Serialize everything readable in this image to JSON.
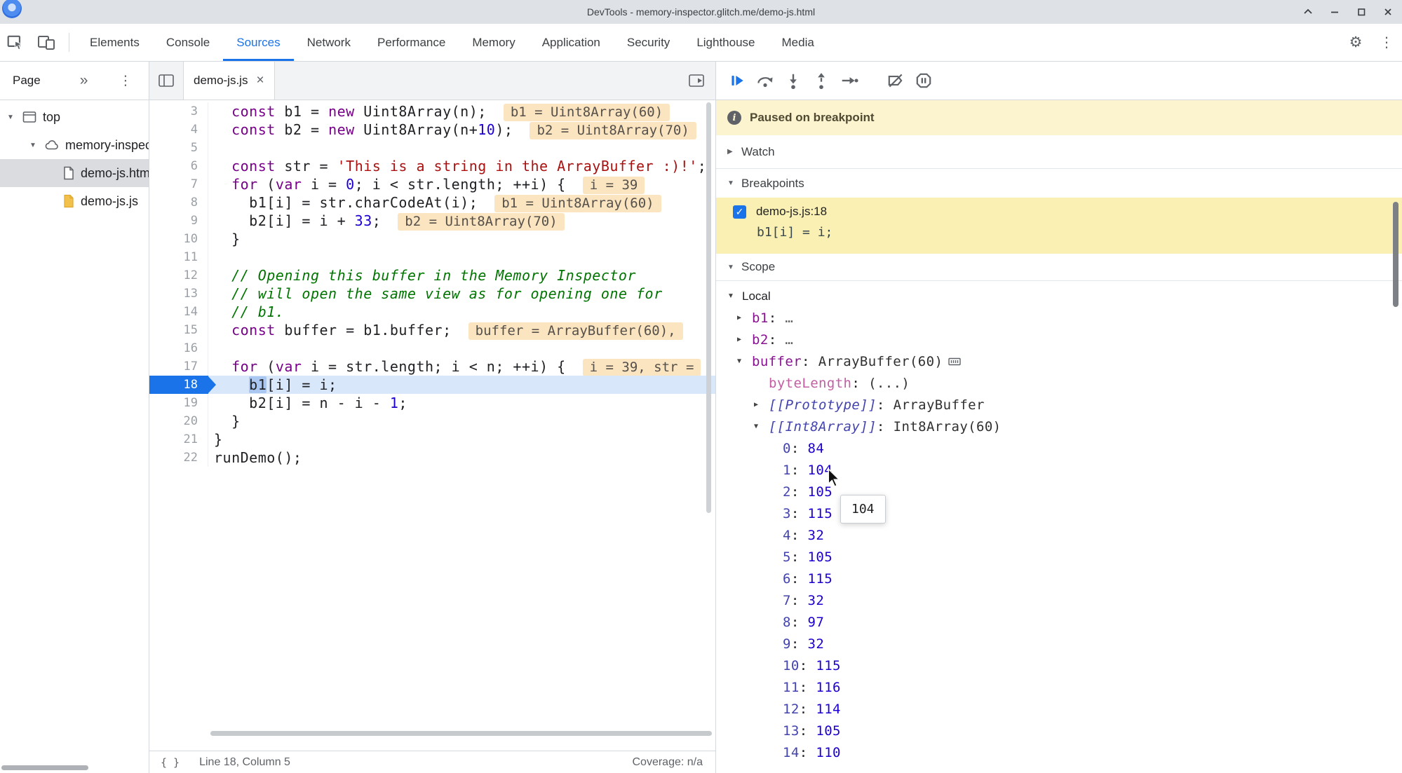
{
  "window": {
    "title": "DevTools - memory-inspector.glitch.me/demo-js.html"
  },
  "icons": {
    "close_tab": "×",
    "kebab": "⋮",
    "chevrons": "»",
    "braces": "{ }",
    "gear": "⚙",
    "tri_r": "▶",
    "tri_d": "▼",
    "info": "i",
    "check": "✓"
  },
  "main_tabs": {
    "items": [
      "Elements",
      "Console",
      "Sources",
      "Network",
      "Performance",
      "Memory",
      "Application",
      "Security",
      "Lighthouse",
      "Media"
    ],
    "active": "Sources"
  },
  "sidebar": {
    "tab_label": "Page",
    "tree": [
      {
        "label": "top",
        "icon": "frame",
        "indent": 0,
        "expander": true,
        "selected": false
      },
      {
        "label": "memory-inspector.glitch.me",
        "icon": "cloud",
        "indent": 1,
        "expander": true,
        "selected": false
      },
      {
        "label": "demo-js.html",
        "icon": "doc-html",
        "indent": 2,
        "expander": false,
        "selected": true
      },
      {
        "label": "demo-js.js",
        "icon": "doc-js",
        "indent": 2,
        "expander": false,
        "selected": false
      }
    ]
  },
  "editor": {
    "tab_label": "demo-js.js",
    "status_line": "Line 18, Column 5",
    "coverage": "Coverage: n/a",
    "current_line": 18,
    "lines": [
      {
        "n": 3,
        "tk": [
          [
            "t",
            "  "
          ],
          [
            "k",
            "const"
          ],
          [
            "t",
            " b1 = "
          ],
          [
            "k",
            "new"
          ],
          [
            "t",
            " Uint8Array(n);"
          ]
        ],
        "hint": "b1 = Uint8Array(60)"
      },
      {
        "n": 4,
        "tk": [
          [
            "t",
            "  "
          ],
          [
            "k",
            "const"
          ],
          [
            "t",
            " b2 = "
          ],
          [
            "k",
            "new"
          ],
          [
            "t",
            " Uint8Array(n+"
          ],
          [
            "n",
            "10"
          ],
          [
            "t",
            ");"
          ]
        ],
        "hint": "b2 = Uint8Array(70)"
      },
      {
        "n": 5,
        "tk": []
      },
      {
        "n": 6,
        "tk": [
          [
            "t",
            "  "
          ],
          [
            "k",
            "const"
          ],
          [
            "t",
            " str = "
          ],
          [
            "s",
            "'This is a string in the ArrayBuffer :)!'"
          ],
          [
            "t",
            ";"
          ]
        ]
      },
      {
        "n": 7,
        "tk": [
          [
            "t",
            "  "
          ],
          [
            "k",
            "for"
          ],
          [
            "t",
            " ("
          ],
          [
            "k",
            "var"
          ],
          [
            "t",
            " i = "
          ],
          [
            "n",
            "0"
          ],
          [
            "t",
            "; i < str.length; ++i) {"
          ]
        ],
        "hint": "i = 39"
      },
      {
        "n": 8,
        "tk": [
          [
            "t",
            "    b1[i] = str.charCodeAt(i);"
          ]
        ],
        "hint": "b1 = Uint8Array(60)"
      },
      {
        "n": 9,
        "tk": [
          [
            "t",
            "    b2[i] = i + "
          ],
          [
            "n",
            "33"
          ],
          [
            "t",
            ";"
          ]
        ],
        "hint": "b2 = Uint8Array(70)"
      },
      {
        "n": 10,
        "tk": [
          [
            "t",
            "  }"
          ]
        ]
      },
      {
        "n": 11,
        "tk": []
      },
      {
        "n": 12,
        "tk": [
          [
            "t",
            "  "
          ],
          [
            "c",
            "// Opening this buffer in the Memory Inspector"
          ]
        ]
      },
      {
        "n": 13,
        "tk": [
          [
            "t",
            "  "
          ],
          [
            "c",
            "// will open the same view as for opening one for"
          ]
        ]
      },
      {
        "n": 14,
        "tk": [
          [
            "t",
            "  "
          ],
          [
            "c",
            "// b1."
          ]
        ]
      },
      {
        "n": 15,
        "tk": [
          [
            "t",
            "  "
          ],
          [
            "k",
            "const"
          ],
          [
            "t",
            " buffer = b1.buffer;"
          ]
        ],
        "hint": "buffer = ArrayBuffer(60),"
      },
      {
        "n": 16,
        "tk": []
      },
      {
        "n": 17,
        "tk": [
          [
            "t",
            "  "
          ],
          [
            "k",
            "for"
          ],
          [
            "t",
            " ("
          ],
          [
            "k",
            "var"
          ],
          [
            "t",
            " i = str.length; i < n; ++i) {"
          ]
        ],
        "hint": "i = 39, str ="
      },
      {
        "n": 18,
        "tk": [
          [
            "t",
            "    "
          ],
          [
            "hl",
            "b1"
          ],
          [
            "t",
            "[i] = i;"
          ]
        ]
      },
      {
        "n": 19,
        "tk": [
          [
            "t",
            "    b2[i] = n - i - "
          ],
          [
            "n",
            "1"
          ],
          [
            "t",
            ";"
          ]
        ]
      },
      {
        "n": 20,
        "tk": [
          [
            "t",
            "  }"
          ]
        ]
      },
      {
        "n": 21,
        "tk": [
          [
            "t",
            "}"
          ]
        ]
      },
      {
        "n": 22,
        "tk": [
          [
            "t",
            "runDemo();"
          ]
        ]
      }
    ]
  },
  "debugger": {
    "paused_message": "Paused on breakpoint",
    "watch_label": "Watch",
    "breakpoints_label": "Breakpoints",
    "scope_label": "Scope",
    "scope_group": "Local",
    "breakpoint": {
      "location": "demo-js.js:18",
      "code": "b1[i] = i;",
      "checked": true
    },
    "entries": [
      {
        "d": 1,
        "a": "r",
        "name": "b1",
        "nc": "prop",
        "value": "…",
        "vc": "dim"
      },
      {
        "d": 1,
        "a": "r",
        "name": "b2",
        "nc": "prop",
        "value": "…",
        "vc": "dim"
      },
      {
        "d": 1,
        "a": "d",
        "name": "buffer",
        "nc": "prop",
        "value": "ArrayBuffer(60)",
        "vc": "obj",
        "icon": "memory"
      },
      {
        "d": 2,
        "a": "",
        "name": "byteLength",
        "nc": "getter",
        "value": "(...)",
        "vc": "obj"
      },
      {
        "d": 2,
        "a": "r",
        "name": "[[Prototype]]",
        "nc": "internal",
        "value": "ArrayBuffer",
        "vc": "obj"
      },
      {
        "d": 2,
        "a": "d",
        "name": "[[Int8Array]]",
        "nc": "internal",
        "value": "Int8Array(60)",
        "vc": "obj"
      },
      {
        "d": 3,
        "a": "",
        "name": "0",
        "nc": "index",
        "value": "84",
        "vc": "num"
      },
      {
        "d": 3,
        "a": "",
        "name": "1",
        "nc": "index",
        "value": "104",
        "vc": "num"
      },
      {
        "d": 3,
        "a": "",
        "name": "2",
        "nc": "index",
        "value": "105",
        "vc": "num"
      },
      {
        "d": 3,
        "a": "",
        "name": "3",
        "nc": "index",
        "value": "115",
        "vc": "num"
      },
      {
        "d": 3,
        "a": "",
        "name": "4",
        "nc": "index",
        "value": "32",
        "vc": "num"
      },
      {
        "d": 3,
        "a": "",
        "name": "5",
        "nc": "index",
        "value": "105",
        "vc": "num"
      },
      {
        "d": 3,
        "a": "",
        "name": "6",
        "nc": "index",
        "value": "115",
        "vc": "num"
      },
      {
        "d": 3,
        "a": "",
        "name": "7",
        "nc": "index",
        "value": "32",
        "vc": "num"
      },
      {
        "d": 3,
        "a": "",
        "name": "8",
        "nc": "index",
        "value": "97",
        "vc": "num"
      },
      {
        "d": 3,
        "a": "",
        "name": "9",
        "nc": "index",
        "value": "32",
        "vc": "num"
      },
      {
        "d": 3,
        "a": "",
        "name": "10",
        "nc": "index",
        "value": "115",
        "vc": "num"
      },
      {
        "d": 3,
        "a": "",
        "name": "11",
        "nc": "index",
        "value": "116",
        "vc": "num"
      },
      {
        "d": 3,
        "a": "",
        "name": "12",
        "nc": "index",
        "value": "114",
        "vc": "num"
      },
      {
        "d": 3,
        "a": "",
        "name": "13",
        "nc": "index",
        "value": "105",
        "vc": "num"
      },
      {
        "d": 3,
        "a": "",
        "name": "14",
        "nc": "index",
        "value": "110",
        "vc": "num"
      }
    ],
    "tooltip": "104"
  }
}
